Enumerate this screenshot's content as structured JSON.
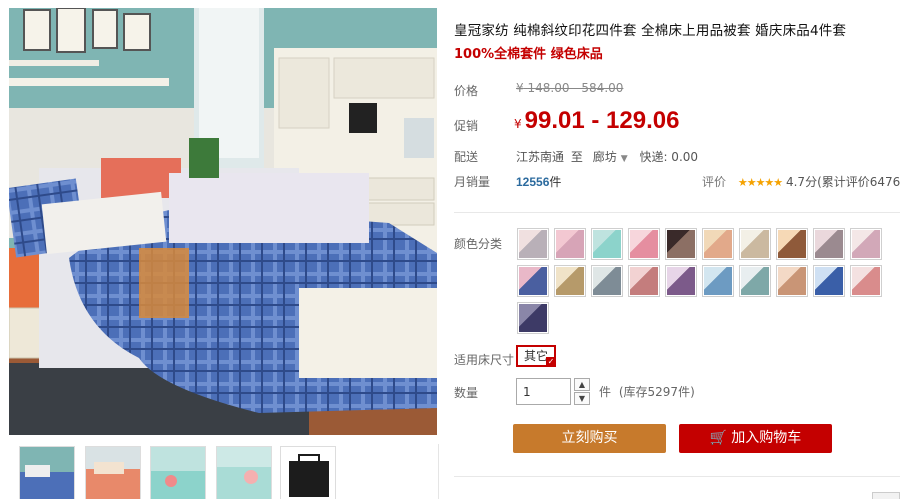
{
  "product": {
    "title": "皇冠家纺 纯棉斜纹印花四件套 全棉床上用品被套 婚庆床品4件套",
    "subtitle": "100%全棉套件 绿色床品"
  },
  "price": {
    "label": "价格",
    "currency": "¥",
    "original": "148.00 - 584.00"
  },
  "promo": {
    "label": "促销",
    "currency": "¥",
    "value": "99.01 - 129.06"
  },
  "delivery": {
    "label": "配送",
    "from": "江苏南通",
    "to_prefix": "至",
    "to": "廊坊",
    "fee": "快递: 0.00"
  },
  "sales": {
    "label": "月销量",
    "count": "12556",
    "unit": "件"
  },
  "rating": {
    "label": "评价",
    "stars": "★★★★★",
    "value": "4.7分(累计评价6476"
  },
  "options": {
    "color_label": "颜色分类",
    "size_label": "适用床尺寸",
    "size_selected": "其它"
  },
  "quantity": {
    "label": "数量",
    "value": "1",
    "unit": "件",
    "stock": "(库存5297件)"
  },
  "buttons": {
    "buy": "立刻购买",
    "cart": "加入购物车"
  },
  "colors": {
    "promo_red": "#c40000",
    "buy_orange": "#c77a2c",
    "star": "#f5a200"
  }
}
